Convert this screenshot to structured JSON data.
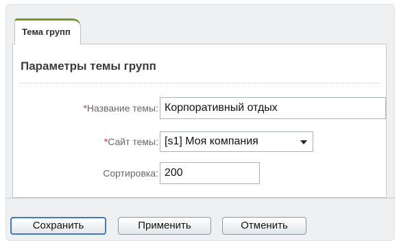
{
  "tab": {
    "label": "Тема групп"
  },
  "panel": {
    "title": "Параметры темы групп"
  },
  "form": {
    "required_mark": "*",
    "name": {
      "label": "Название темы:",
      "value": "Корпоративный отдых"
    },
    "site": {
      "label": "Сайт темы:",
      "value": "[s1] Моя компания"
    },
    "sort": {
      "label": "Сортировка:",
      "value": "200"
    }
  },
  "buttons": {
    "save": "Сохранить",
    "apply": "Применить",
    "cancel": "Отменить"
  },
  "colors": {
    "tab_accent": "#6c9b20",
    "required": "#e0312b",
    "primary_border": "#3d78c7"
  }
}
